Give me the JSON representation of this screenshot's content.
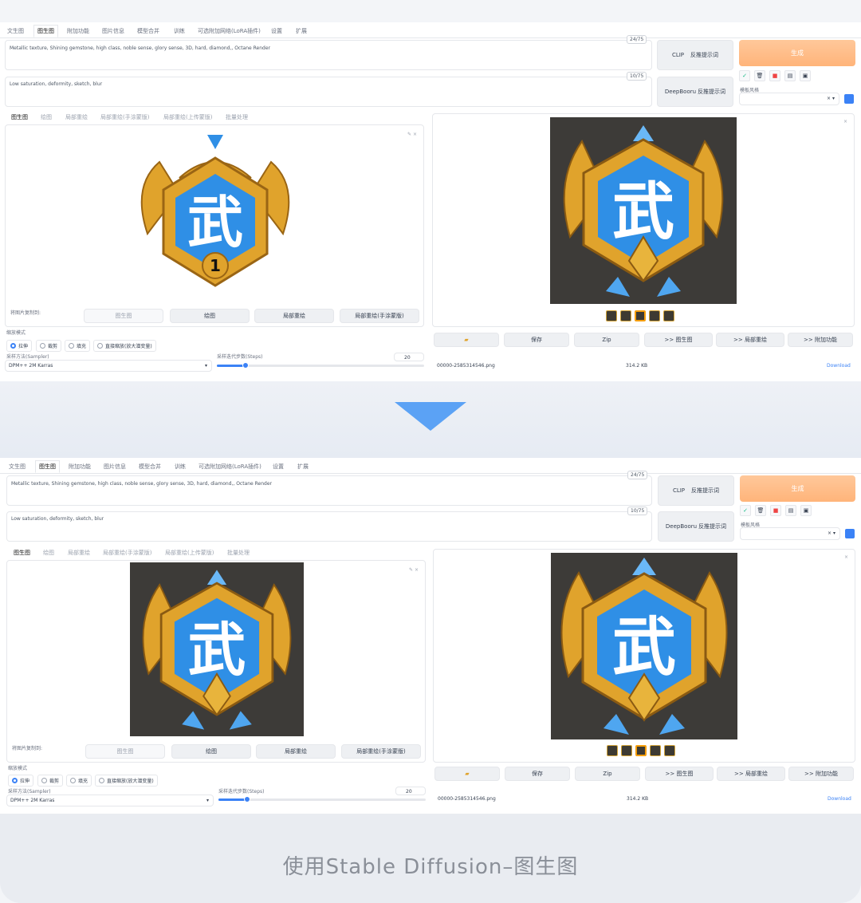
{
  "tabs": [
    "文生图",
    "图生图",
    "附加功能",
    "图片信息",
    "模型合并",
    "训练",
    "可选附加网络(LoRA插件)",
    "设置",
    "扩展"
  ],
  "prompt": {
    "text": "Metallic texture,  Shining gemstone, high class, noble sense, glory sense, 3D, hard, diamond,,  Octane Render",
    "counter": "24/75"
  },
  "negative": {
    "text": "Low saturation, deformity, sketch, blur",
    "counter": "10/75"
  },
  "buttons": {
    "clip": "CLIP",
    "clip_reverse": "反推提示词",
    "deepbooru": "DeepBooru",
    "deepbooru_reverse": "反推提示词",
    "generate": "生成"
  },
  "style_label": "模板风格",
  "subtabs": [
    "图生图",
    "绘图",
    "局部重绘",
    "局部重绘(手涂蒙版)",
    "局部重绘(上传蒙版)",
    "批量处理"
  ],
  "copy_label": "将图片复制到:",
  "copy_buttons": [
    "图生图",
    "绘图",
    "局部重绘",
    "局部重绘(手涂蒙版)"
  ],
  "resize_label": "缩放模式",
  "resize_options": [
    "拉伸",
    "裁剪",
    "填充",
    "直接缩放(放大潜变量)"
  ],
  "sampler": {
    "label": "采样方法(Sampler)",
    "value": "DPM++ 2M Karras"
  },
  "steps": {
    "label": "采样迭代步数(Steps)",
    "value": "20",
    "fraction": 0.19
  },
  "output_buttons": [
    "保存",
    "Zip",
    ">> 图生图",
    ">> 局部重绘",
    ">> 附加功能"
  ],
  "file": {
    "name": "00000-2585314546.png",
    "size": "314.2 KB",
    "download": "Download"
  },
  "caption": "使用Stable Diffusion–图生图",
  "colors": {
    "accent": "#3b82f6",
    "generate": "#ffb47a",
    "arrow": "#5ba2f5",
    "gold": "#e0a32c",
    "gem": "#2f8fe6"
  }
}
